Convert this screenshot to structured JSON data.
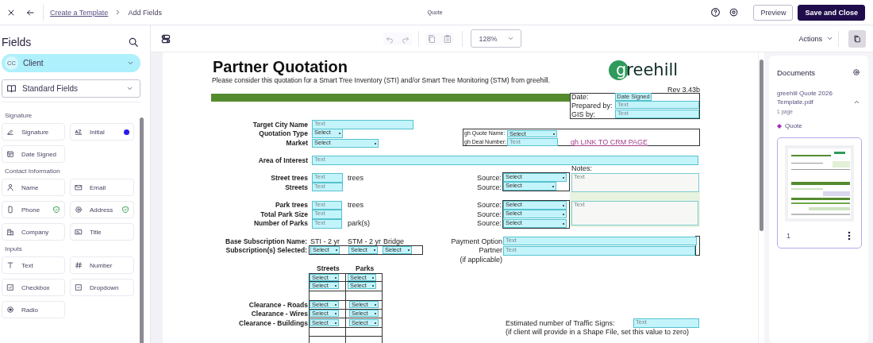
{
  "topbar": {
    "breadcrumb": [
      {
        "text": "Create a Template",
        "kind": "link"
      },
      {
        "text": "Add Fields",
        "kind": "current"
      }
    ],
    "title": "Quote",
    "buttons": [
      {
        "text": "Preview",
        "kind": "secondary"
      },
      {
        "text": "Save and Close",
        "kind": "primary"
      }
    ]
  },
  "sidebar": {
    "title": "Fields",
    "recipient": {
      "initials": "CC",
      "name": "Client"
    },
    "field_set": "Standard Fields",
    "groups": [
      {
        "title": "Signature",
        "items": [
          {
            "label": "Signature",
            "kind": "signature",
            "flagged": false,
            "verified": false
          },
          {
            "label": "Initial",
            "kind": "initial",
            "flagged": true,
            "verified": false
          },
          {
            "label": "Date Signed",
            "kind": "date",
            "flagged": false,
            "verified": false
          }
        ]
      },
      {
        "title": "Contact Information",
        "items": [
          {
            "label": "Name",
            "kind": "name",
            "flagged": false,
            "verified": false
          },
          {
            "label": "Email",
            "kind": "email",
            "flagged": false,
            "verified": false
          },
          {
            "label": "Phone",
            "kind": "phone",
            "flagged": false,
            "verified": true
          },
          {
            "label": "Address",
            "kind": "address",
            "flagged": false,
            "verified": true
          },
          {
            "label": "Company",
            "kind": "company",
            "flagged": false,
            "verified": false
          },
          {
            "label": "Title",
            "kind": "title",
            "flagged": false,
            "verified": false
          }
        ]
      },
      {
        "title": "Inputs",
        "items": [
          {
            "label": "Text",
            "kind": "text",
            "flagged": false,
            "verified": false
          },
          {
            "label": "Number",
            "kind": "number",
            "flagged": false,
            "verified": false
          },
          {
            "label": "Checkbox",
            "kind": "checkbox",
            "flagged": false,
            "verified": false
          },
          {
            "label": "Dropdown",
            "kind": "dropdown",
            "flagged": false,
            "verified": false
          },
          {
            "label": "Radio",
            "kind": "radio",
            "flagged": false,
            "verified": false
          }
        ]
      }
    ]
  },
  "toolbar": {
    "zoom": "128%",
    "actions": "Actions"
  },
  "document": {
    "items": [
      {
        "kind": "heading",
        "text": "Partner Quotation"
      },
      {
        "kind": "subtitle",
        "text": "Please consider this quotation for a Smart Tree Inventory (STI) and/or Smart Tree Monitoring (STM) from greehill."
      },
      {
        "kind": "logo",
        "text": "greehill"
      },
      {
        "kind": "note",
        "text": "Rev 3.43b"
      },
      {
        "kind": "label",
        "text": "Date:"
      },
      {
        "kind": "date_field",
        "text": "Date Signed"
      },
      {
        "kind": "label",
        "text": "Prepared by:"
      },
      {
        "kind": "text_field",
        "text": "Text"
      },
      {
        "kind": "label",
        "text": "GIS by:"
      },
      {
        "kind": "text_field",
        "text": "Text"
      },
      {
        "kind": "bold_label",
        "text": "Target City Name"
      },
      {
        "kind": "text_field",
        "text": "Text"
      },
      {
        "kind": "bold_label",
        "text": "Quotation Type"
      },
      {
        "kind": "select",
        "text": "Select"
      },
      {
        "kind": "bold_label",
        "text": "Market"
      },
      {
        "kind": "select",
        "text": "Select"
      },
      {
        "kind": "small_label",
        "text": "gh Quote Name:"
      },
      {
        "kind": "select",
        "text": "Select"
      },
      {
        "kind": "small_label",
        "text": "gh Deal Number:"
      },
      {
        "kind": "text_field",
        "text": "Text"
      },
      {
        "kind": "link",
        "text": "gh LINK TO CRM PAGE"
      },
      {
        "kind": "bold_label",
        "text": "Area of Interest"
      },
      {
        "kind": "text_field",
        "text": "Text"
      },
      {
        "kind": "label",
        "text": "Notes:"
      },
      {
        "kind": "bold_label",
        "text": "Street trees"
      },
      {
        "kind": "text_field",
        "text": "Text"
      },
      {
        "kind": "label",
        "text": "trees"
      },
      {
        "kind": "bold_label",
        "text": "Streets"
      },
      {
        "kind": "text_field",
        "text": "Text"
      },
      {
        "kind": "label",
        "text": "Source:"
      },
      {
        "kind": "select",
        "text": "Select"
      },
      {
        "kind": "label",
        "text": "Source:"
      },
      {
        "kind": "select",
        "text": "Select"
      },
      {
        "kind": "text_area",
        "text": "Text"
      },
      {
        "kind": "bold_label",
        "text": "Park trees"
      },
      {
        "kind": "text_field",
        "text": "Text"
      },
      {
        "kind": "label",
        "text": "trees"
      },
      {
        "kind": "bold_label",
        "text": "Total Park Size"
      },
      {
        "kind": "text_field",
        "text": "Text"
      },
      {
        "kind": "bold_label",
        "text": "Number of Parks"
      },
      {
        "kind": "text_field",
        "text": "Text"
      },
      {
        "kind": "label",
        "text": "park(s)"
      },
      {
        "kind": "label",
        "text": "Source:"
      },
      {
        "kind": "select",
        "text": "Select"
      },
      {
        "kind": "label",
        "text": "Source:"
      },
      {
        "kind": "select",
        "text": "Select"
      },
      {
        "kind": "label",
        "text": "Source:"
      },
      {
        "kind": "select",
        "text": "Select"
      },
      {
        "kind": "text_area",
        "text": "Text"
      },
      {
        "kind": "bold_label",
        "text": "Base Subscription Name:"
      },
      {
        "kind": "label",
        "text": "STI - 2 yr"
      },
      {
        "kind": "label",
        "text": "STM - 2 yr"
      },
      {
        "kind": "label",
        "text": "Bridge"
      },
      {
        "kind": "bold_label",
        "text": "Subscription(s) Selected:"
      },
      {
        "kind": "select",
        "text": "Select"
      },
      {
        "kind": "select",
        "text": "Select"
      },
      {
        "kind": "select",
        "text": "Select"
      },
      {
        "kind": "label",
        "text": "Payment Option"
      },
      {
        "kind": "text_field",
        "text": "Text"
      },
      {
        "kind": "label",
        "text": "Partner"
      },
      {
        "kind": "text_field",
        "text": "Text"
      },
      {
        "kind": "label",
        "text": "(if applicable)"
      },
      {
        "kind": "bold_label",
        "text": "Streets"
      },
      {
        "kind": "bold_label",
        "text": "Parks"
      },
      {
        "kind": "select",
        "text": "Select"
      },
      {
        "kind": "select",
        "text": "Select"
      },
      {
        "kind": "select",
        "text": "Select"
      },
      {
        "kind": "select",
        "text": "Select"
      },
      {
        "kind": "bold_label",
        "text": "Clearance - Roads"
      },
      {
        "kind": "select",
        "text": "Select"
      },
      {
        "kind": "select",
        "text": "Select"
      },
      {
        "kind": "bold_label",
        "text": "Clearance - Wires"
      },
      {
        "kind": "select",
        "text": "Select"
      },
      {
        "kind": "select",
        "text": "Select"
      },
      {
        "kind": "bold_label",
        "text": "Clearance - Buildings"
      },
      {
        "kind": "select",
        "text": "Select"
      },
      {
        "kind": "select",
        "text": "Select"
      },
      {
        "kind": "label",
        "text": "Estimated number of Traffic Signs:"
      },
      {
        "kind": "text_field",
        "text": "Text"
      },
      {
        "kind": "label",
        "text": "(if client will provide in a Shape File, set this value to zero)"
      }
    ]
  },
  "documents_panel": {
    "title": "Documents",
    "file_name": "greehill Quote 2026 Template.pdf",
    "pages": "1 page",
    "expanded": true,
    "template": "Quote",
    "page_number": "1"
  }
}
